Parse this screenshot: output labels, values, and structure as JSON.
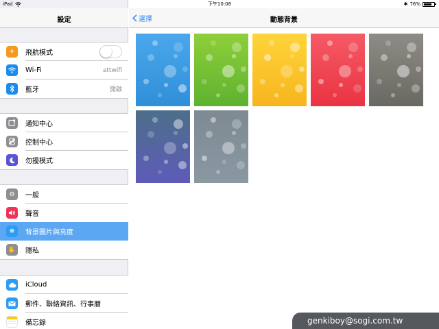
{
  "statusbar": {
    "device": "iPad",
    "time": "下午10:08",
    "battery": "76%",
    "battery_level": 0.76
  },
  "sidebar": {
    "title": "設定",
    "groups": [
      [
        {
          "label": "飛航模式",
          "icon": "airplane-icon",
          "color": "#f39a1f",
          "control": "toggle",
          "on": false
        },
        {
          "label": "Wi-Fi",
          "icon": "wifi-icon",
          "color": "#1a8cf0",
          "value": "attwifi"
        },
        {
          "label": "藍牙",
          "icon": "bluetooth-icon",
          "color": "#1a8cf0",
          "value": "開啟"
        }
      ],
      [
        {
          "label": "通知中心",
          "icon": "notification-center-icon",
          "color": "#8e8e93"
        },
        {
          "label": "控制中心",
          "icon": "control-center-icon",
          "color": "#8e8e93"
        },
        {
          "label": "勿擾模式",
          "icon": "moon-icon",
          "color": "#5856d6"
        }
      ],
      [
        {
          "label": "一般",
          "icon": "gear-icon",
          "color": "#8e8e93"
        },
        {
          "label": "聲音",
          "icon": "speaker-icon",
          "color": "#f0335a"
        },
        {
          "label": "背景圖片與亮度",
          "icon": "wallpaper-icon",
          "color": "#2d9cf2",
          "selected": true
        },
        {
          "label": "隱私",
          "icon": "hand-icon",
          "color": "#8e8e93"
        }
      ],
      [
        {
          "label": "iCloud",
          "icon": "cloud-icon",
          "color": "#2d9cf2"
        },
        {
          "label": "郵件、聯絡資訊、行事曆",
          "icon": "mail-icon",
          "color": "#2d9cf2"
        },
        {
          "label": "備忘錄",
          "icon": "notes-icon",
          "color": "#ffcc00"
        }
      ]
    ]
  },
  "main": {
    "back_label": "選擇",
    "title": "動態背景",
    "wallpapers": [
      {
        "name": "blue",
        "top": "#4aa7ec",
        "bottom": "#2f8fd8"
      },
      {
        "name": "green",
        "top": "#8fcf3a",
        "bottom": "#5eb22f"
      },
      {
        "name": "yellow",
        "top": "#ffd43a",
        "bottom": "#f7b51e"
      },
      {
        "name": "red",
        "top": "#f55a65",
        "bottom": "#ea3342"
      },
      {
        "name": "gray",
        "top": "#8e8c85",
        "bottom": "#6a6862"
      },
      {
        "name": "blue-purple",
        "top": "#4d6f8a",
        "bottom": "#5e5bb8"
      },
      {
        "name": "gray-blue",
        "top": "#7d8a93",
        "bottom": "#8a98a2"
      }
    ]
  },
  "watermark": "genkiboy@sogi.com.tw"
}
